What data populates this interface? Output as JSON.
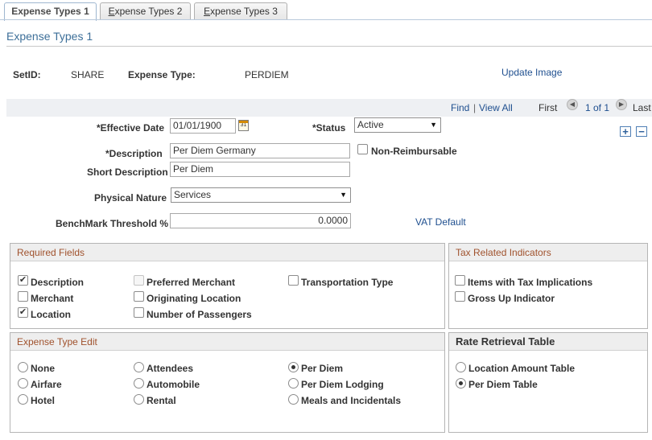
{
  "tabs": [
    {
      "label": "Expense Types 1",
      "first": "E",
      "rest": "xpense Types 1"
    },
    {
      "label": "Expense Types 2",
      "first": "E",
      "rest": "xpense Types 2"
    },
    {
      "label": "Expense Types 3",
      "first": "E",
      "rest": "xpense Types 3"
    }
  ],
  "page_title": "Expense Types 1",
  "header": {
    "setid_label": "SetID:",
    "setid_value": "SHARE",
    "expense_type_label": "Expense Type:",
    "expense_type_value": "PERDIEM",
    "update_image": "Update Image"
  },
  "nav": {
    "find": "Find",
    "sep": "|",
    "view_all": "View All",
    "first": "First",
    "range": "1 of 1",
    "last": "Last"
  },
  "form": {
    "effective_date_label": "*Effective Date",
    "effective_date_value": "01/01/1900",
    "status_label": "*Status",
    "status_value": "Active",
    "description_label": "*Description",
    "description_value": "Per Diem Germany",
    "non_reimbursable_label": "Non-Reimbursable",
    "short_description_label": "Short Description",
    "short_description_value": "Per Diem",
    "physical_nature_label": "Physical Nature",
    "physical_nature_value": "Services",
    "benchmark_label": "BenchMark Threshold %",
    "benchmark_value": "0.0000",
    "vat_default": "VAT Default"
  },
  "required_fields": {
    "title": "Required Fields",
    "items": [
      {
        "label": "Description",
        "checked": true
      },
      {
        "label": "Merchant",
        "checked": false
      },
      {
        "label": "Location",
        "checked": true
      },
      {
        "label": "Preferred Merchant",
        "checked": false,
        "disabled": true
      },
      {
        "label": "Originating Location",
        "checked": false
      },
      {
        "label": "Number of Passengers",
        "checked": false
      },
      {
        "label": "Transportation Type",
        "checked": false
      }
    ]
  },
  "tax_indicators": {
    "title": "Tax Related Indicators",
    "items": [
      {
        "label": "Items with Tax Implications",
        "checked": false
      },
      {
        "label": "Gross Up Indicator",
        "checked": false
      }
    ]
  },
  "expense_type_edit": {
    "title": "Expense Type Edit",
    "selected": "Per Diem",
    "items": [
      {
        "label": "None"
      },
      {
        "label": "Airfare"
      },
      {
        "label": "Hotel"
      },
      {
        "label": "Attendees"
      },
      {
        "label": "Automobile"
      },
      {
        "label": "Rental"
      },
      {
        "label": "Per Diem"
      },
      {
        "label": "Per Diem Lodging"
      },
      {
        "label": "Meals and Incidentals"
      }
    ]
  },
  "rate_retrieval": {
    "title": "Rate Retrieval Table",
    "selected": "Per Diem Table",
    "items": [
      {
        "label": "Location Amount Table"
      },
      {
        "label": "Per Diem Table"
      }
    ]
  }
}
